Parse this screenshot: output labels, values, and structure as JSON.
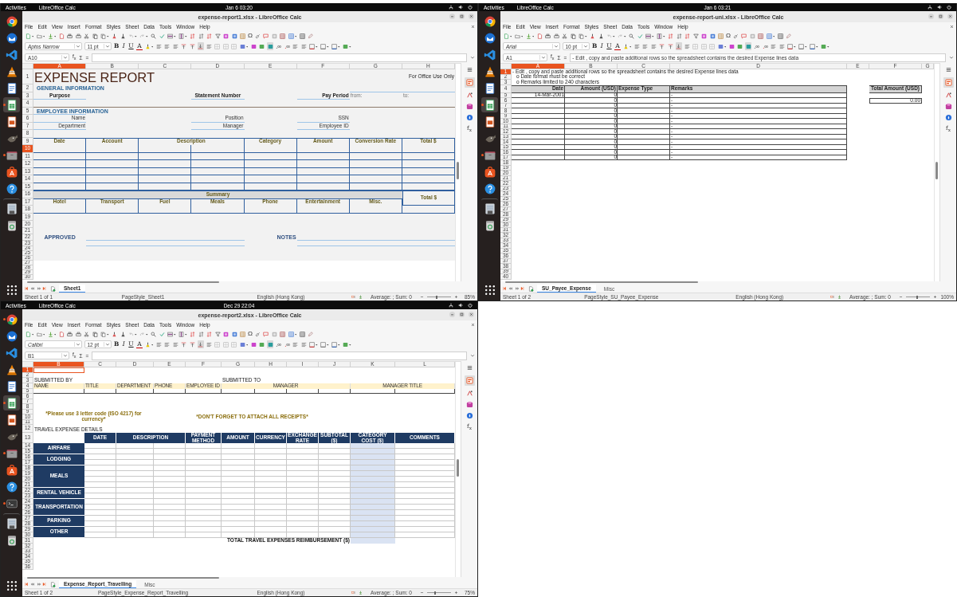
{
  "screens": [
    {
      "top_bar": {
        "activities": "Activities",
        "app": "LibreOffice Calc",
        "clock": "Jan 6  03:20"
      },
      "dock": [
        {
          "kind": "browser",
          "running": false,
          "selected": false
        },
        {
          "kind": "mail",
          "running": false,
          "selected": false
        },
        {
          "kind": "code",
          "running": false,
          "selected": false
        },
        {
          "kind": "cone",
          "running": false,
          "selected": false
        },
        {
          "kind": "document",
          "running": false,
          "selected": false
        },
        {
          "kind": "spreadsheet",
          "running": true,
          "selected": true
        },
        {
          "kind": "slides",
          "running": false,
          "selected": false
        },
        {
          "kind": "paint",
          "running": false,
          "selected": false
        },
        {
          "kind": "folder",
          "running": true,
          "selected": false
        },
        {
          "kind": "store",
          "running": false,
          "selected": false
        },
        {
          "kind": "help",
          "running": false,
          "selected": false
        },
        {
          "kind": "disk",
          "running": false,
          "selected": false
        },
        {
          "kind": "trash",
          "running": false,
          "selected": false
        },
        {
          "kind": "apps",
          "running": false,
          "selected": false
        }
      ],
      "window": {
        "title": "expense-report1.xlsx - LibreOffice Calc",
        "menu": [
          "File",
          "Edit",
          "View",
          "Insert",
          "Format",
          "Styles",
          "Sheet",
          "Data",
          "Tools",
          "Window",
          "Help"
        ],
        "special_char": "Ω",
        "font": "Aptos Narrow",
        "size": "11 pt",
        "format_buttons": [
          {
            "label": "B",
            "kind": "bold"
          },
          {
            "label": "I",
            "kind": "italic"
          },
          {
            "label": "U",
            "kind": "underline"
          },
          {
            "label": "A",
            "kind": "font-color"
          }
        ],
        "cell_ref": "A10",
        "formula_buttons": [
          "f$_{x}$",
          "Σ",
          "="
        ],
        "sidebar_function": "f$_{x}$",
        "columns": [
          {
            "label": "A",
            "selected": true
          },
          {
            "label": "B",
            "selected": false
          },
          {
            "label": "C",
            "selected": false
          },
          {
            "label": "D",
            "selected": false
          },
          {
            "label": "E",
            "selected": false
          },
          {
            "label": "F",
            "selected": false
          },
          {
            "label": "G",
            "selected": false
          },
          {
            "label": "H",
            "selected": false
          }
        ],
        "rows": [
          {
            "label": "1",
            "selected": false
          },
          {
            "label": "2",
            "selected": false
          },
          {
            "label": "3",
            "selected": false
          },
          {
            "label": "4",
            "selected": false
          },
          {
            "label": "5",
            "selected": false
          },
          {
            "label": "6",
            "selected": false
          },
          {
            "label": "7",
            "selected": false
          },
          {
            "label": "8",
            "selected": false
          },
          {
            "label": "9",
            "selected": false
          },
          {
            "label": "10",
            "selected": true
          },
          {
            "label": "11",
            "selected": false
          },
          {
            "label": "12",
            "selected": false
          },
          {
            "label": "13",
            "selected": false
          },
          {
            "label": "14",
            "selected": false
          },
          {
            "label": "15",
            "selected": false
          },
          {
            "label": "16",
            "selected": false
          },
          {
            "label": "17",
            "selected": false
          },
          {
            "label": "18",
            "selected": false
          },
          {
            "label": "19",
            "selected": false
          },
          {
            "label": "20",
            "selected": false
          },
          {
            "label": "21",
            "selected": false
          },
          {
            "label": "22",
            "selected": false
          },
          {
            "label": "23",
            "selected": false
          },
          {
            "label": "24",
            "selected": false
          },
          {
            "label": "25",
            "selected": false
          },
          {
            "label": "26",
            "selected": false
          },
          {
            "label": "27",
            "selected": false
          },
          {
            "label": "28",
            "selected": false
          },
          {
            "label": "29",
            "selected": false
          },
          {
            "label": "30",
            "selected": false
          }
        ],
        "cells": [
          {
            "text": "EXPENSE REPORT",
            "kind": "title"
          },
          {
            "text": "For Office Use Only",
            "kind": "note"
          },
          {
            "text": "GENERAL INFORMATION",
            "kind": "section"
          },
          {
            "text": "Purpose",
            "kind": "label-center"
          },
          {
            "text": "Statement Number",
            "kind": "label-center"
          },
          {
            "text": "Pay Period",
            "kind": "label-right"
          },
          {
            "text": "from:",
            "kind": "hint"
          },
          {
            "text": "to:",
            "kind": "hint"
          },
          {
            "text": "EMPLOYEE INFORMATION",
            "kind": "section"
          },
          {
            "text": "Name",
            "kind": "field-label"
          },
          {
            "text": "Position",
            "kind": "field-label"
          },
          {
            "text": "SSN",
            "kind": "field-label"
          },
          {
            "text": "Department",
            "kind": "field-label"
          },
          {
            "text": "Manager",
            "kind": "field-label"
          },
          {
            "text": "Employee ID",
            "kind": "field-label"
          },
          {
            "text": "Date",
            "kind": "colhead"
          },
          {
            "text": "Account",
            "kind": "colhead"
          },
          {
            "text": "Description",
            "kind": "colhead"
          },
          {
            "text": "Category",
            "kind": "colhead"
          },
          {
            "text": "Amount",
            "kind": "colhead"
          },
          {
            "text": "Conversion Rate",
            "kind": "colhead"
          },
          {
            "text": "Total $",
            "kind": "colhead"
          },
          {
            "text": "Summary",
            "kind": "summary"
          },
          {
            "text": "Total $",
            "kind": "colhead-box"
          },
          {
            "text": "Hotel",
            "kind": "colhead"
          },
          {
            "text": "Transport",
            "kind": "colhead"
          },
          {
            "text": "Fuel",
            "kind": "colhead"
          },
          {
            "text": "Meals",
            "kind": "colhead"
          },
          {
            "text": "Phone",
            "kind": "colhead"
          },
          {
            "text": "Entertainment",
            "kind": "colhead"
          },
          {
            "text": "Misc.",
            "kind": "colhead"
          },
          {
            "text": "APPROVED",
            "kind": "sign"
          },
          {
            "text": "NOTES",
            "kind": "sign-right"
          }
        ],
        "tabs": [
          {
            "label": "Sheet1",
            "selected": true
          }
        ],
        "status": {
          "sheet": "Sheet 1 of 1",
          "page_style": "PageStyle_Sheet1",
          "language": "English (Hong Kong)",
          "summary": "Average: ; Sum: 0",
          "zoom": "85%",
          "slider": {
            "level": 0.39
          }
        }
      }
    },
    {
      "top_bar": {
        "activities": "Activities",
        "app": "LibreOffice Calc",
        "clock": "Jan 6  03:21"
      },
      "dock": [
        {
          "kind": "browser",
          "running": false,
          "selected": false
        },
        {
          "kind": "mail",
          "running": false,
          "selected": false
        },
        {
          "kind": "code",
          "running": false,
          "selected": false
        },
        {
          "kind": "cone",
          "running": false,
          "selected": false
        },
        {
          "kind": "document",
          "running": false,
          "selected": false
        },
        {
          "kind": "spreadsheet",
          "running": true,
          "selected": true
        },
        {
          "kind": "slides",
          "running": false,
          "selected": false
        },
        {
          "kind": "paint",
          "running": false,
          "selected": false
        },
        {
          "kind": "folder",
          "running": true,
          "selected": false
        },
        {
          "kind": "store",
          "running": false,
          "selected": false
        },
        {
          "kind": "help",
          "running": false,
          "selected": false
        },
        {
          "kind": "disk",
          "running": false,
          "selected": false
        },
        {
          "kind": "trash",
          "running": false,
          "selected": false
        },
        {
          "kind": "apps",
          "running": false,
          "selected": false
        }
      ],
      "window": {
        "title": "expense-report-uni.xlsx - LibreOffice Calc",
        "menu": [
          "File",
          "Edit",
          "View",
          "Insert",
          "Format",
          "Styles",
          "Sheet",
          "Data",
          "Tools",
          "Window",
          "Help"
        ],
        "special_char": "Ω",
        "font": "Arial",
        "size": "10 pt",
        "format_buttons": [
          {
            "label": "B",
            "kind": "bold"
          },
          {
            "label": "I",
            "kind": "italic"
          },
          {
            "label": "U",
            "kind": "underline"
          },
          {
            "label": "A",
            "kind": "font-color"
          }
        ],
        "cell_ref": "A1",
        "formula_buttons": [
          "f$_{x}$",
          "Σ",
          "="
        ],
        "sidebar_function": "f$_{x}$",
        "formula": "- Edit , copy and paste additional rows so the spreadsheet contains the desired Expense lines data",
        "columns": [
          {
            "label": "A",
            "selected": true
          },
          {
            "label": "B",
            "selected": false
          },
          {
            "label": "C",
            "selected": false
          },
          {
            "label": "D",
            "selected": false
          },
          {
            "label": "E",
            "selected": false
          },
          {
            "label": "F",
            "selected": false
          },
          {
            "label": "G",
            "selected": false
          }
        ],
        "rows": [
          {
            "label": "1",
            "selected": true
          },
          {
            "label": "2",
            "selected": false
          },
          {
            "label": "3",
            "selected": false
          },
          {
            "label": "4",
            "selected": false
          },
          {
            "label": "5",
            "selected": false
          },
          {
            "label": "6",
            "selected": false
          },
          {
            "label": "7",
            "selected": false
          },
          {
            "label": "8",
            "selected": false
          },
          {
            "label": "9",
            "selected": false
          },
          {
            "label": "10",
            "selected": false
          },
          {
            "label": "11",
            "selected": false
          },
          {
            "label": "12",
            "selected": false
          },
          {
            "label": "13",
            "selected": false
          },
          {
            "label": "14",
            "selected": false
          },
          {
            "label": "15",
            "selected": false
          },
          {
            "label": "16",
            "selected": false
          },
          {
            "label": "17",
            "selected": false
          },
          {
            "label": "18",
            "selected": false
          },
          {
            "label": "19",
            "selected": false
          },
          {
            "label": "20",
            "selected": false
          },
          {
            "label": "21",
            "selected": false
          },
          {
            "label": "22",
            "selected": false
          },
          {
            "label": "23",
            "selected": false
          },
          {
            "label": "24",
            "selected": false
          },
          {
            "label": "25",
            "selected": false
          },
          {
            "label": "26",
            "selected": false
          },
          {
            "label": "27",
            "selected": false
          },
          {
            "label": "28",
            "selected": false
          },
          {
            "label": "29",
            "selected": false
          },
          {
            "label": "30",
            "selected": false
          },
          {
            "label": "31",
            "selected": false
          },
          {
            "label": "32",
            "selected": false
          },
          {
            "label": "33",
            "selected": false
          },
          {
            "label": "34",
            "selected": false
          },
          {
            "label": "35",
            "selected": false
          },
          {
            "label": "36",
            "selected": false
          },
          {
            "label": "37",
            "selected": false
          },
          {
            "label": "38",
            "selected": false
          },
          {
            "label": "39",
            "selected": false
          },
          {
            "label": "40",
            "selected": false
          }
        ],
        "cells": [
          {
            "text": "- Edit , copy and paste additional rows so the spreadsheet contains the desired Expense lines data",
            "kind": "overflow"
          },
          {
            "text": "o Date format must be correct",
            "kind": "overflow-indent"
          },
          {
            "text": "o Remarks limited to 240 characters",
            "kind": "overflow-indent"
          },
          {
            "text": "Date",
            "kind": "gray-right"
          },
          {
            "text": "Amount (USD)",
            "kind": "gray-right"
          },
          {
            "text": "Expense Type",
            "kind": "gray-left"
          },
          {
            "text": "Remarks",
            "kind": "gray-left"
          },
          {
            "text": "Total Amount (USD)",
            "kind": "gray-center"
          },
          {
            "text": "14-Mar-2001",
            "kind": "num"
          },
          {
            "text": "0",
            "kind": "num"
          },
          {
            "text": "-",
            "kind": "text"
          },
          {
            "text": "0",
            "kind": "num"
          },
          {
            "text": "-",
            "kind": "text"
          },
          {
            "text": "0.00",
            "kind": "boxed-num"
          },
          {
            "text": "0",
            "kind": "num"
          },
          {
            "text": "-",
            "kind": "text"
          },
          {
            "text": "0",
            "kind": "num"
          },
          {
            "text": "-",
            "kind": "text"
          },
          {
            "text": "0",
            "kind": "num"
          },
          {
            "text": "-",
            "kind": "text"
          },
          {
            "text": "0",
            "kind": "num"
          },
          {
            "text": "-",
            "kind": "text"
          },
          {
            "text": "0",
            "kind": "num"
          },
          {
            "text": "-",
            "kind": "text"
          },
          {
            "text": "0",
            "kind": "num"
          },
          {
            "text": "-",
            "kind": "text"
          },
          {
            "text": "0",
            "kind": "num"
          },
          {
            "text": "-",
            "kind": "text"
          },
          {
            "text": "0",
            "kind": "num"
          },
          {
            "text": "-",
            "kind": "text"
          },
          {
            "text": "0",
            "kind": "num"
          },
          {
            "text": "-",
            "kind": "text"
          },
          {
            "text": "0",
            "kind": "num"
          },
          {
            "text": "-",
            "kind": "text"
          },
          {
            "text": "0",
            "kind": "num"
          },
          {
            "text": "-",
            "kind": "text"
          }
        ],
        "tabs": [
          {
            "label": "SU_Payee_Expense",
            "selected": true
          },
          {
            "label": "Misc",
            "selected": false
          }
        ],
        "status": {
          "sheet": "Sheet 1 of 2",
          "page_style": "PageStyle_SU_Payee_Expense",
          "language": "English (Hong Kong)",
          "summary": "Average: ; Sum: 0",
          "zoom": "100%",
          "slider": {
            "level": 0.47
          }
        }
      }
    },
    {
      "top_bar": {
        "activities": "Activities",
        "app": "LibreOffice Calc",
        "clock": "Dec 29  22:04"
      },
      "dock": [
        {
          "kind": "browser",
          "running": true,
          "selected": false
        },
        {
          "kind": "mail",
          "running": false,
          "selected": false
        },
        {
          "kind": "code",
          "running": false,
          "selected": false
        },
        {
          "kind": "cone",
          "running": false,
          "selected": false
        },
        {
          "kind": "document",
          "running": false,
          "selected": false
        },
        {
          "kind": "spreadsheet",
          "running": true,
          "selected": true
        },
        {
          "kind": "slides",
          "running": false,
          "selected": false
        },
        {
          "kind": "paint",
          "running": false,
          "selected": false
        },
        {
          "kind": "folder",
          "running": true,
          "selected": false
        },
        {
          "kind": "store",
          "running": false,
          "selected": false
        },
        {
          "kind": "help",
          "running": false,
          "selected": false
        },
        {
          "kind": "terminal",
          "running": true,
          "selected": false
        },
        {
          "kind": "disk",
          "running": false,
          "selected": false
        },
        {
          "kind": "trash",
          "running": false,
          "selected": false
        },
        {
          "kind": "apps",
          "running": false,
          "selected": false
        }
      ],
      "window": {
        "title": "expense-report2.xlsx - LibreOffice Calc",
        "menu": [
          "File",
          "Edit",
          "View",
          "Insert",
          "Format",
          "Styles",
          "Sheet",
          "Data",
          "Tools",
          "Window",
          "Help"
        ],
        "special_char": "Ω",
        "font": "Calibri",
        "size": "12 pt",
        "format_buttons": [
          {
            "label": "B",
            "kind": "bold"
          },
          {
            "label": "I",
            "kind": "italic"
          },
          {
            "label": "U",
            "kind": "underline"
          },
          {
            "label": "A",
            "kind": "font-color"
          }
        ],
        "cell_ref": "B1",
        "formula_buttons": [
          "f$_{x}$",
          "Σ",
          "="
        ],
        "sidebar_function": "f$_{x}$",
        "columns": [
          {
            "label": "B",
            "selected": true
          },
          {
            "label": "C",
            "selected": false
          },
          {
            "label": "D",
            "selected": false
          },
          {
            "label": "E",
            "selected": false
          },
          {
            "label": "F",
            "selected": false
          },
          {
            "label": "G",
            "selected": false
          },
          {
            "label": "H",
            "selected": false
          },
          {
            "label": "I",
            "selected": false
          },
          {
            "label": "J",
            "selected": false
          },
          {
            "label": "K",
            "selected": false
          },
          {
            "label": "L",
            "selected": false
          }
        ],
        "rows": [
          {
            "label": "1",
            "selected": true
          },
          {
            "label": "2",
            "selected": false
          },
          {
            "label": "3",
            "selected": false
          },
          {
            "label": "4",
            "selected": false
          },
          {
            "label": "5",
            "selected": false
          },
          {
            "label": "6",
            "selected": false
          },
          {
            "label": "7",
            "selected": false
          },
          {
            "label": "8",
            "selected": false
          },
          {
            "label": "9",
            "selected": false
          },
          {
            "label": "10",
            "selected": false
          },
          {
            "label": "11",
            "selected": false
          },
          {
            "label": "12",
            "selected": false
          },
          {
            "label": "13",
            "selected": false
          },
          {
            "label": "14",
            "selected": false
          },
          {
            "label": "15",
            "selected": false
          },
          {
            "label": "16",
            "selected": false
          },
          {
            "label": "17",
            "selected": false
          },
          {
            "label": "18",
            "selected": false
          },
          {
            "label": "19",
            "selected": false
          },
          {
            "label": "20",
            "selected": false
          },
          {
            "label": "21",
            "selected": false
          },
          {
            "label": "22",
            "selected": false
          },
          {
            "label": "23",
            "selected": false
          },
          {
            "label": "24",
            "selected": false
          },
          {
            "label": "25",
            "selected": false
          },
          {
            "label": "26",
            "selected": false
          },
          {
            "label": "27",
            "selected": false
          },
          {
            "label": "28",
            "selected": false
          },
          {
            "label": "29",
            "selected": false
          },
          {
            "label": "30",
            "selected": false
          },
          {
            "label": "31",
            "selected": false
          },
          {
            "label": "32",
            "selected": false
          },
          {
            "label": "33",
            "selected": false
          },
          {
            "label": "34",
            "selected": false
          },
          {
            "label": "35",
            "selected": false
          },
          {
            "label": "36",
            "selected": false
          }
        ],
        "cells": [
          {
            "text": "SUBMITTED BY",
            "kind": "plain"
          },
          {
            "text": "SUBMITTED TO",
            "kind": "plain"
          },
          {
            "text": "NAME",
            "kind": "yellow-left"
          },
          {
            "text": "TITLE",
            "kind": "yellow-left"
          },
          {
            "text": "DEPARTMENT",
            "kind": "yellow-left"
          },
          {
            "text": "PHONE",
            "kind": "yellow-left"
          },
          {
            "text": "EMPLOYEE ID",
            "kind": "yellow-left"
          },
          {
            "text": "MANAGER",
            "kind": "yellow-center"
          },
          {
            "text": "MANAGER TITLE",
            "kind": "yellow-center"
          },
          {
            "text": "*Please use 3 letter code (ISO 4217) for currency*",
            "kind": "notice"
          },
          {
            "text": "*DON'T FORGET TO ATTACH ALL RECEIPTS*",
            "kind": "notice"
          },
          {
            "text": "TRAVEL EXPENSE DETAILS",
            "kind": "plain"
          },
          {
            "text": "DATE",
            "kind": "navy-head"
          },
          {
            "text": "DESCRIPTION",
            "kind": "navy-head"
          },
          {
            "text": "PAYMENT METHOD",
            "kind": "navy-head"
          },
          {
            "text": "AMOUNT",
            "kind": "navy-head"
          },
          {
            "text": "CURRENCY",
            "kind": "navy-head"
          },
          {
            "text": "EXCHANGE RATE",
            "kind": "navy-head"
          },
          {
            "text": "SUBTOTAL ($)",
            "kind": "navy-head"
          },
          {
            "text": "CATEGORY COST ($)",
            "kind": "navy-head"
          },
          {
            "text": "COMMENTS",
            "kind": "navy-head"
          },
          {
            "text": "AIRFARE",
            "kind": "category"
          },
          {
            "text": "LODGING",
            "kind": "category"
          },
          {
            "text": "MEALS",
            "kind": "category"
          },
          {
            "text": "RENTAL VEHICLE",
            "kind": "category"
          },
          {
            "text": "TRANSPORTATION",
            "kind": "category"
          },
          {
            "text": "PARKING",
            "kind": "category"
          },
          {
            "text": "OTHER",
            "kind": "category"
          },
          {
            "text": "TOTAL TRAVEL EXPENSES REIMBURSEMENT ($)",
            "kind": "total"
          }
        ],
        "tabs": [
          {
            "label": "Expense_Report_Travelling",
            "selected": true
          },
          {
            "label": "Misc",
            "selected": false
          }
        ],
        "status": {
          "sheet": "Sheet 1 of 2",
          "page_style": "PageStyle_Expense_Report_Travelling",
          "language": "English (Hong Kong)",
          "summary": "Average: ; Sum: 0",
          "zoom": "75%",
          "slider": {
            "level": 0.33
          }
        }
      }
    }
  ]
}
